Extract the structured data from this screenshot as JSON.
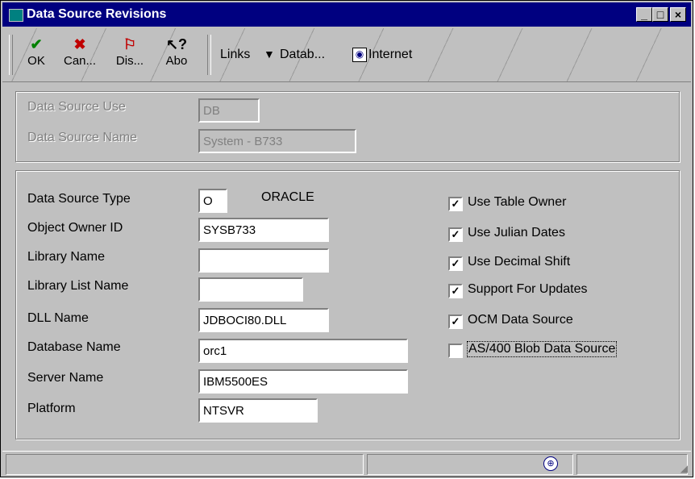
{
  "window": {
    "title": "Data Source Revisions",
    "controls": {
      "minimize": "_",
      "maximize": "□",
      "close": "×"
    }
  },
  "toolbar": {
    "buttons": [
      {
        "label": "OK",
        "icon": "checkmark-icon",
        "color": "#008000"
      },
      {
        "label": "Can...",
        "icon": "x-icon",
        "color": "#c00000"
      },
      {
        "label": "Dis...",
        "icon": "display-icon",
        "color": "#c00000"
      },
      {
        "label": "Abo",
        "icon": "help-pointer-icon",
        "color": "#000000"
      }
    ],
    "links_label": "Links",
    "datab_label": "Datab...",
    "internet_label": "Internet"
  },
  "header": {
    "data_source_use_label": "Data Source Use",
    "data_source_use_value": "DB",
    "data_source_name_label": "Data Source Name",
    "data_source_name_value": "System - B733"
  },
  "form": {
    "data_source_type_label": "Data Source Type",
    "data_source_type_value": "O",
    "data_source_type_desc": "ORACLE",
    "object_owner_id_label": "Object Owner ID",
    "object_owner_id_value": "SYSB733",
    "library_name_label": "Library Name",
    "library_name_value": "",
    "library_list_name_label": "Library List Name",
    "library_list_name_value": "",
    "dll_name_label": "DLL Name",
    "dll_name_value": "JDBOCI80.DLL",
    "database_name_label": "Database Name",
    "database_name_value": "orc1",
    "server_name_label": "Server Name",
    "server_name_value": "IBM5500ES",
    "platform_label": "Platform",
    "platform_value": "NTSVR"
  },
  "options": {
    "use_table_owner": {
      "label": "Use Table Owner",
      "mark": "✓"
    },
    "use_julian_dates": {
      "label": "Use Julian Dates",
      "mark": "✓"
    },
    "use_decimal_shift": {
      "label": "Use Decimal Shift",
      "mark": "✓"
    },
    "support_for_updates": {
      "label": "Support For Updates",
      "mark": "✓"
    },
    "ocm_data_source": {
      "label": "OCM Data Source",
      "mark": "✓"
    },
    "as400_blob_data_source": {
      "label": "AS/400 Blob Data Source",
      "mark": ""
    }
  },
  "status": {
    "globe_icon": "globe-icon"
  }
}
